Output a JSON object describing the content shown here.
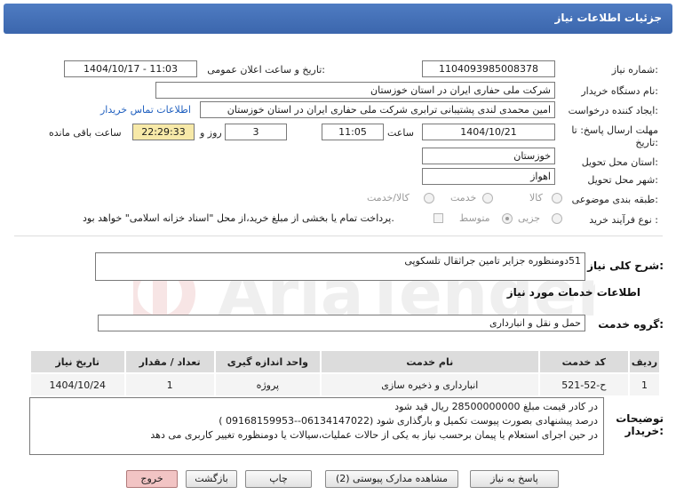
{
  "header": {
    "title": "جزئیات اطلاعات نیاز"
  },
  "fields": {
    "need_number_label": "شماره نیاز:",
    "need_number": "1104093985008378",
    "announce_label": "تاریخ و ساعت اعلان عمومی:",
    "announce_value": "1404/10/17 - 11:03",
    "buyer_org_label": "نام دستگاه خریدار:",
    "buyer_org": "شرکت ملی حفاری ایران در استان خوزستان",
    "requester_label": "ایجاد کننده درخواست:",
    "requester": "امین محمدی لندی پشتیبانی ترابری شرکت ملی حفاری ایران در استان خوزستان",
    "contact_link": "اطلاعات تماس خریدار",
    "deadline_label_1": "مهلت ارسال پاسخ: تا",
    "deadline_label_2": "تاریخ:",
    "deadline_date": "1404/10/21",
    "time_label": "ساعت",
    "deadline_time": "11:05",
    "days_value": "3",
    "days_label": "روز و",
    "remaining_time": "22:29:33",
    "remaining_label": "ساعت باقی مانده",
    "province_label": "استان محل تحویل:",
    "province": "خوزستان",
    "city_label": "شهر محل تحویل:",
    "city": "اهواز",
    "category_label": "طبقه بندی موضوعی:",
    "category_options": [
      "کالا",
      "خدمت",
      "کالا/خدمت"
    ],
    "process_label": "نوع فرآیند خرید :",
    "process_options": [
      "جزیی",
      "متوسط"
    ],
    "payment_text": "پرداخت تمام یا بخشی از مبلغ خرید،از محل \"اسناد خزانه اسلامی\" خواهد بود."
  },
  "summary": {
    "label": "شرح کلی نیاز:",
    "value": "51دومنظوره جزایر تامین جراثقال تلسکوپی"
  },
  "services_heading": "اطلاعات خدمات مورد نیاز",
  "service_group": {
    "label": "گروه خدمت:",
    "value": "حمل و نقل و انبارداری"
  },
  "table": {
    "headers": [
      "ردیف",
      "کد خدمت",
      "نام خدمت",
      "واحد اندازه گیری",
      "تعداد / مقدار",
      "تاریخ نیاز"
    ],
    "rows": [
      [
        "1",
        "ح-52-521",
        "انبارداری و ذخیره سازی",
        "پروژه",
        "1",
        "1404/10/24"
      ]
    ]
  },
  "notes": {
    "label_1": "توضیحات",
    "label_2": "خریدار:",
    "lines": [
      "در کادر قیمت مبلغ 28500000000 ریال قید شود",
      "درصد پیشنهادی بصورت پیوست تکمیل و بارگذاری شود (06134147022--09168159953 )",
      "در حین اجرای استعلام یا پیمان برحسب نیاز به یکی از حالات عملیات،سیالات یا دومنظوره تغییر کاربری می دهد"
    ]
  },
  "buttons": {
    "reply": "پاسخ به نیاز",
    "attachments": "مشاهده مدارک پیوستی (2)",
    "print": "چاپ",
    "back": "بازگشت",
    "exit": "خروج"
  },
  "watermark": {
    "text": "AriaTender.net"
  },
  "colors": {
    "titlebar": "#4a76bf",
    "highlight": "#f7e9a8",
    "exit_button": "#f2c4c4"
  }
}
